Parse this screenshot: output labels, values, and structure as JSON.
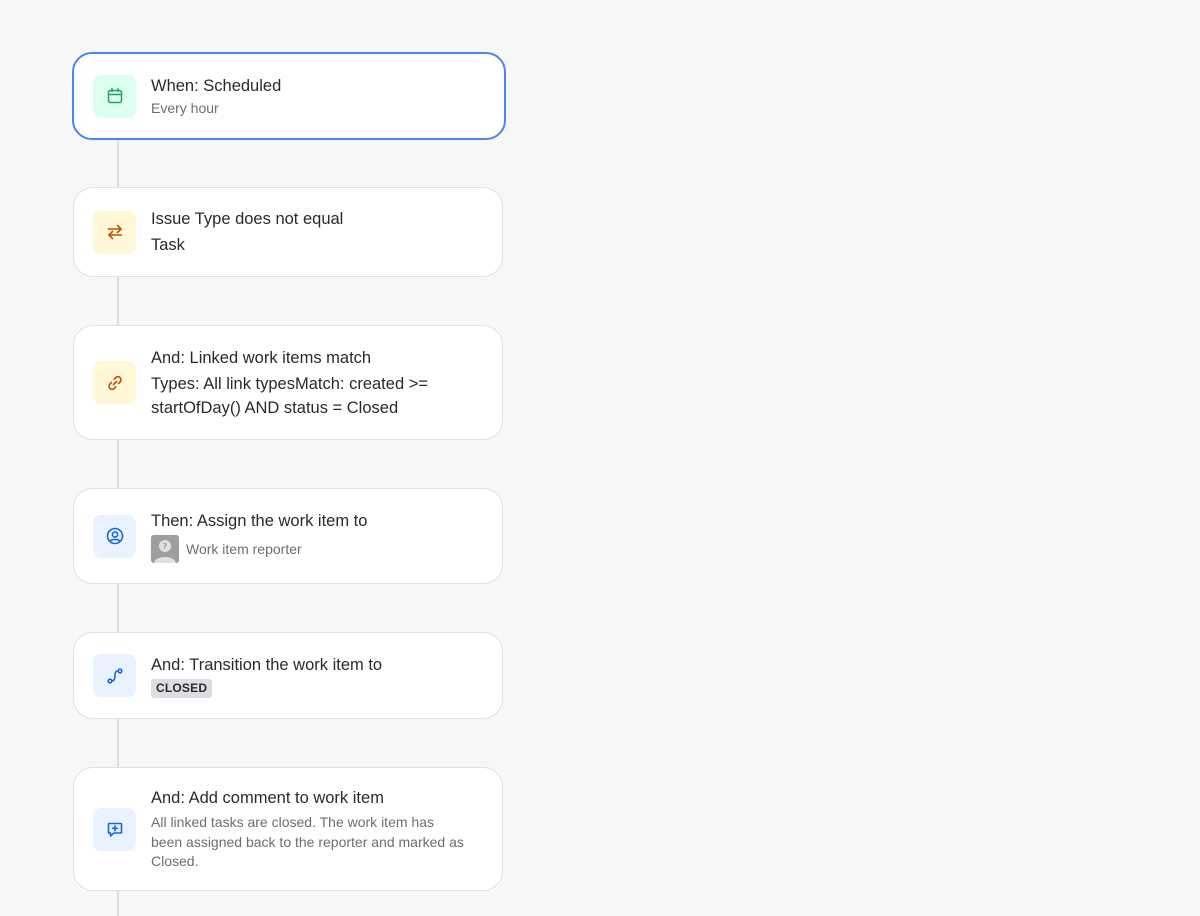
{
  "flow": {
    "steps": [
      {
        "icon": "calendar-icon",
        "title": "When: Scheduled",
        "subtitle": "Every hour",
        "selected": true,
        "icon_color": "#22a06b",
        "icon_bg": "#dcfff1"
      },
      {
        "icon": "swap-arrows-icon",
        "title": "Issue Type does not equal",
        "subtitle": "Task",
        "icon_color": "#c25100",
        "icon_bg": "#fff7d6"
      },
      {
        "icon": "link-icon",
        "title": "And: Linked work items match",
        "subtitle": "Types: All link typesMatch: created >= startOfDay() AND status = Closed",
        "icon_color": "#c25100",
        "icon_bg": "#fff7d6"
      },
      {
        "icon": "user-circle-icon",
        "title": "Then: Assign the work item to",
        "assignee": "Work item reporter",
        "icon_color": "#1868db",
        "icon_bg": "#e9f2fe"
      },
      {
        "icon": "transition-icon",
        "title": "And: Transition the work item to",
        "status": "CLOSED",
        "icon_color": "#1868db",
        "icon_bg": "#e9f2fe"
      },
      {
        "icon": "comment-add-icon",
        "title": "And: Add comment to work item",
        "comment": "All linked tasks are closed. The work item has been assigned back to the reporter and marked as Closed.",
        "icon_color": "#1868db",
        "icon_bg": "#e9f2fe"
      }
    ]
  },
  "colors": {
    "background": "#f7f7f7",
    "selected_border": "#4688ec",
    "connector": "#dcdddf"
  }
}
